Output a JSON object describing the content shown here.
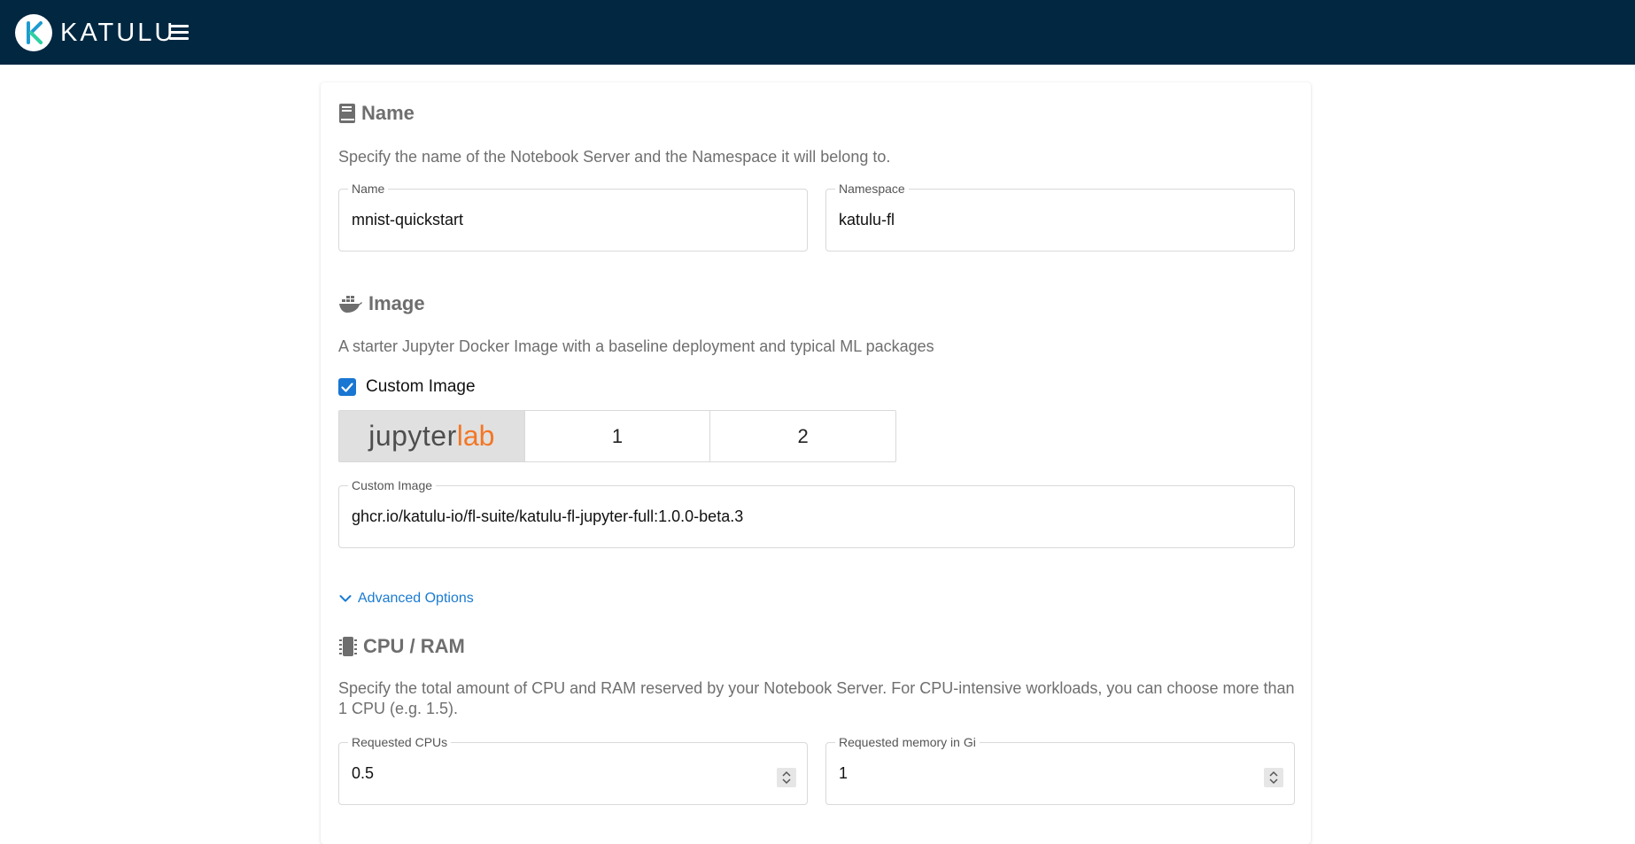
{
  "header": {
    "logo_letter": "K",
    "brand": "KATULU",
    "menu_icon": "hamburger-menu-icon"
  },
  "sections": {
    "name": {
      "icon": "book-icon",
      "title": "Name",
      "description": "Specify the name of the Notebook Server and the Namespace it will belong to.",
      "name_label": "Name",
      "name_value": "mnist-quickstart",
      "namespace_label": "Namespace",
      "namespace_value": "katulu-fl"
    },
    "image": {
      "icon": "docker-whale-icon",
      "title": "Image",
      "description": "A starter Jupyter Docker Image with a baseline deployment and typical ML packages",
      "custom_image_checkbox_label": "Custom Image",
      "custom_image_checked": true,
      "options": [
        {
          "label_part1": "jupyter",
          "label_part2": "lab",
          "selected": true
        },
        {
          "label": "1",
          "selected": false
        },
        {
          "label": "2",
          "selected": false
        }
      ],
      "custom_image_label": "Custom Image",
      "custom_image_value": "ghcr.io/katulu-io/fl-suite/katulu-fl-jupyter-full:1.0.0-beta.3"
    },
    "advanced": {
      "icon": "chevron-down-icon",
      "label": "Advanced Options"
    },
    "cpu_ram": {
      "icon": "chip-icon",
      "title": "CPU / RAM",
      "description": "Specify the total amount of CPU and RAM reserved by your Notebook Server. For CPU-intensive workloads, you can choose more than 1 CPU (e.g. 1.5).",
      "cpu_label": "Requested CPUs",
      "cpu_value": "0.5",
      "memory_label": "Requested memory in Gi",
      "memory_value": "1"
    }
  },
  "colors": {
    "topbar": "#012741",
    "accent": "#1976d2",
    "link": "#1a7bd1",
    "jupyter_orange": "#f37726"
  }
}
